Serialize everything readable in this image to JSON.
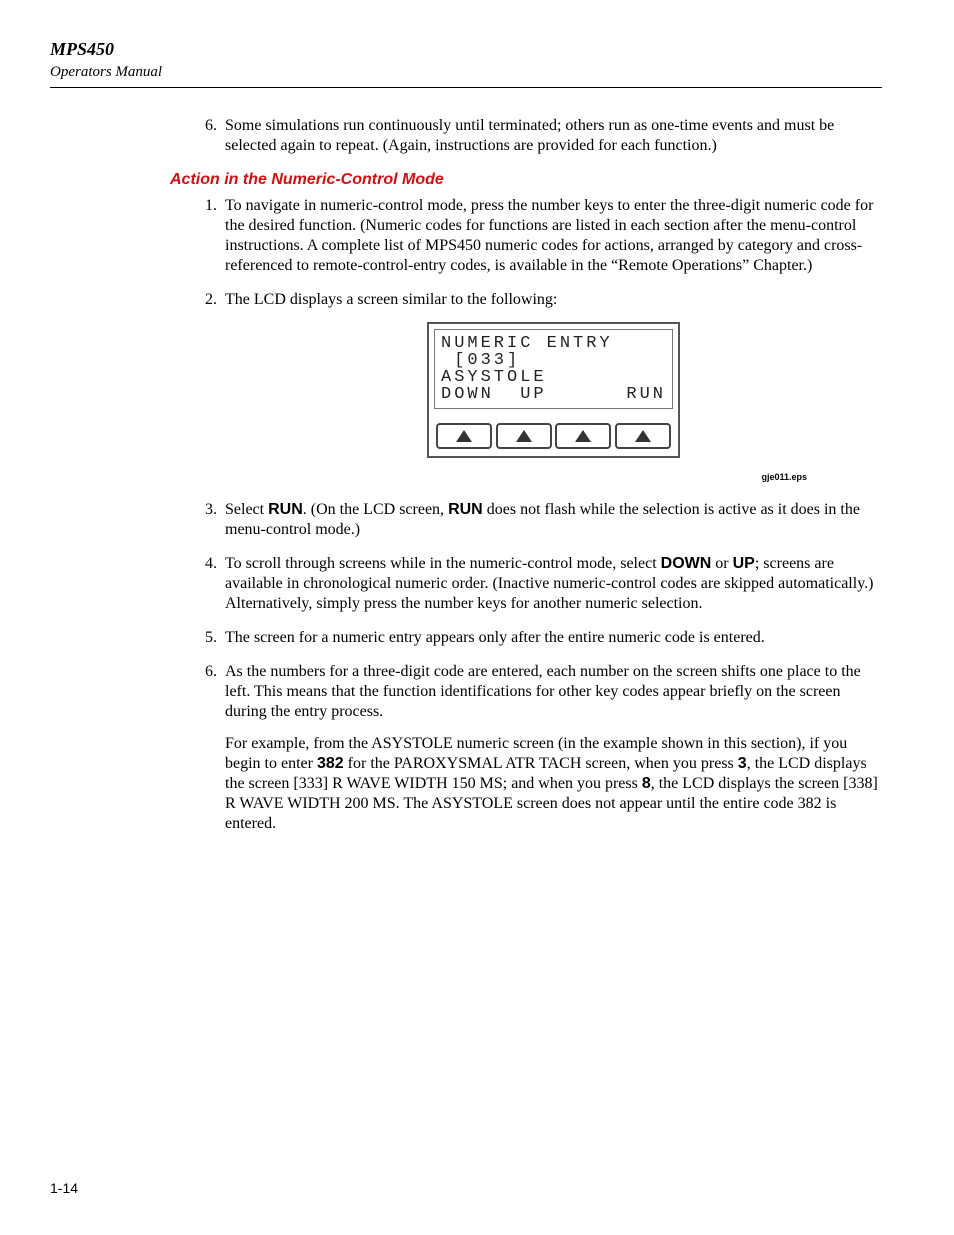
{
  "header": {
    "title": "MPS450",
    "subtitle": "Operators Manual"
  },
  "top_list": [
    {
      "n": "6.",
      "text": "Some simulations run continuously until terminated; others run as one-time events and must be selected again to repeat. (Again, instructions are provided for each function.)"
    }
  ],
  "section_heading": "Action in the Numeric-Control Mode",
  "list2": {
    "i1": {
      "n": "1.",
      "text": "To navigate in numeric-control mode, press the number keys to enter the three-digit numeric code for the desired function. (Numeric codes for functions are listed in each section after the menu-control instructions. A complete list of MPS450 numeric codes for actions, arranged by category and cross-referenced to remote-control-entry codes, is available in the “Remote Operations” Chapter.)"
    },
    "i2": {
      "n": "2.",
      "text": "The LCD displays a screen similar to the following:"
    },
    "i3": {
      "n": "3.",
      "pre1": "Select ",
      "b1": "RUN",
      "mid1": ". (On the LCD screen, ",
      "b2": "RUN",
      "post1": " does not flash while the selection is active as it does in the menu‑control mode.)"
    },
    "i4": {
      "n": "4.",
      "pre1": "To scroll through screens while in the numeric-control mode, select ",
      "b1": "DOWN",
      "mid1": " or ",
      "b2": "UP",
      "post1": "; screens are available in chronological numeric order. (Inactive numeric-control codes are skipped automatically.) Alternatively, simply press the number keys for another numeric selection."
    },
    "i5": {
      "n": "5.",
      "text": "The screen for a numeric entry appears only after the entire numeric code is entered."
    },
    "i6": {
      "n": "6.",
      "p1": "As the numbers for a three-digit code are entered, each number on the screen shifts one place to the left. This means that the function identifications for other key codes appear briefly on the screen during the entry process.",
      "p2_a": "For example, from the ASYSTOLE numeric screen (in the example shown in this section), if you begin to enter ",
      "p2_b1": "382",
      "p2_b": " for the PAROXYSMAL ATR TACH screen, when you press ",
      "p2_b2": "3",
      "p2_c": ", the LCD displays the screen [333] R WAVE WIDTH 150 MS; and when you press ",
      "p2_b3": "8",
      "p2_d": ", the LCD displays the screen [338] R WAVE WIDTH 200 MS. The ASYSTOLE screen does not appear until the entire code 382 is entered."
    }
  },
  "lcd": {
    "line1": "NUMERIC ENTRY",
    "line2": " [033]",
    "line3": "ASYSTOLE",
    "line4_left": "DOWN  UP",
    "line4_right": "RUN"
  },
  "figure_caption": "gje011.eps",
  "page_number": "1-14"
}
